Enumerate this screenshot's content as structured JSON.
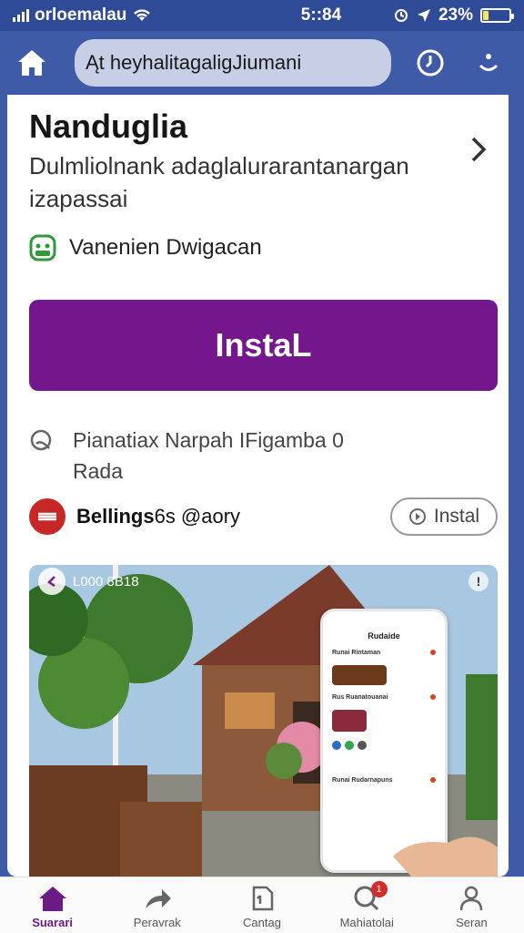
{
  "status_bar": {
    "carrier": "orloemalau",
    "time": "5::84",
    "battery": "23%",
    "battery_level": 0.23
  },
  "browser": {
    "url": "Ąt heyhalitagaligJiumani"
  },
  "app": {
    "title": "Nanduglia",
    "description": "Dulmliolnank adaglaluraranta­nargan izapassai",
    "developer": "Vanenien Dwigacan",
    "install_label": "InstaL",
    "rating_text": "Pianatiax Narpah IFigamba 0 Rada"
  },
  "related": {
    "name_bold": "Bellings",
    "name_rest": "6s @aory",
    "install_label": "Instal"
  },
  "preview": {
    "overlay_left": "L000 8B18",
    "phone_title": "Rudaide",
    "phone_rows": [
      "Runai Rintaman",
      "Rus Ruanatouanai",
      "Runai Rudarnapuns"
    ]
  },
  "bottom_nav": {
    "items": [
      {
        "label": "Suarari",
        "icon": "home-icon",
        "active": true
      },
      {
        "label": "Peravrak",
        "icon": "share-icon",
        "active": false
      },
      {
        "label": "Cantag",
        "icon": "document-icon",
        "active": false
      },
      {
        "label": "Mahiatolai",
        "icon": "search-icon",
        "active": false,
        "badge": "1"
      },
      {
        "label": "Seran",
        "icon": "person-icon",
        "active": false
      }
    ]
  },
  "colors": {
    "accent": "#74168c",
    "header": "#3f5aa6",
    "status_bar": "#2f4a96"
  }
}
